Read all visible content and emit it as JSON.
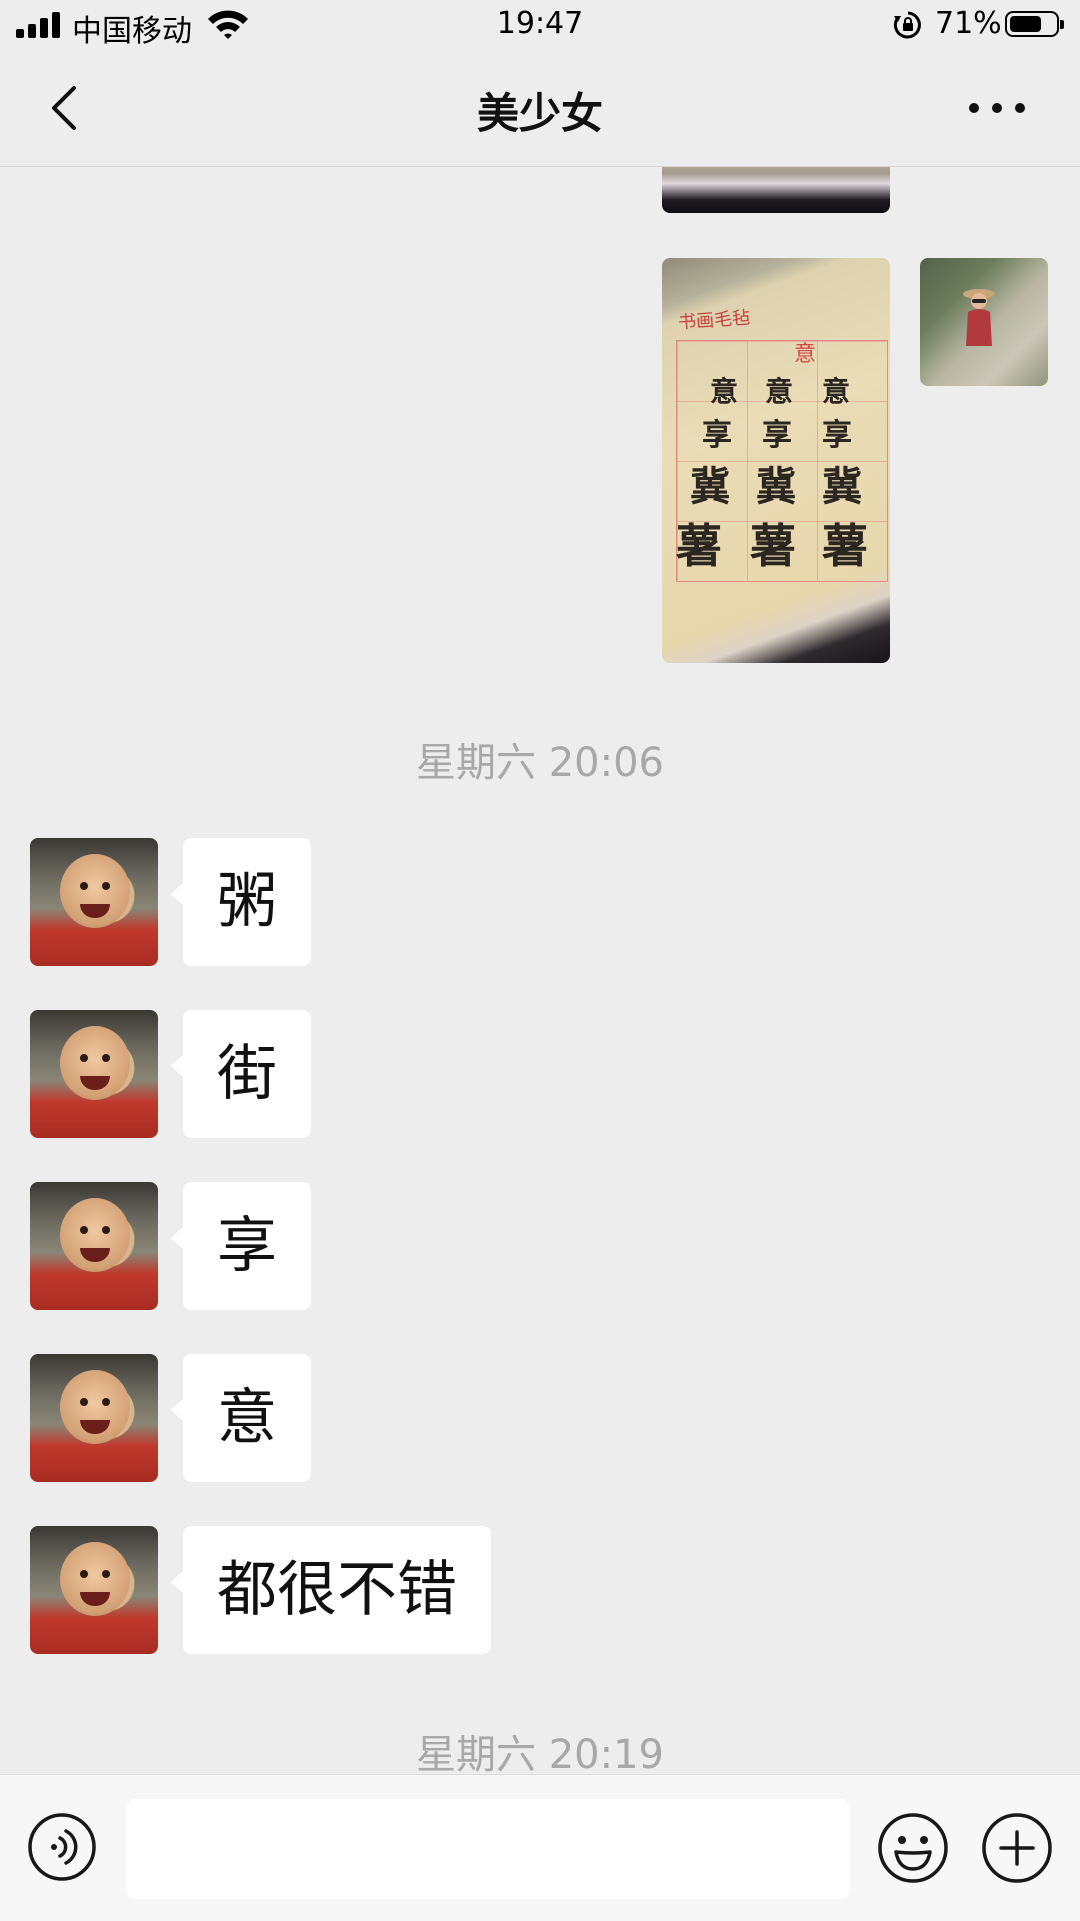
{
  "status_bar": {
    "carrier": "中国移动",
    "time": "19:47",
    "battery_percent": "71%",
    "battery_level": 0.71,
    "icons": [
      "signal-icon",
      "wifi-icon",
      "rotation-lock-icon",
      "battery-icon"
    ]
  },
  "nav": {
    "title": "美少女",
    "back_icon": "chevron-left-icon",
    "more_icon": "more-dots-icon"
  },
  "photo_text": {
    "felt_title": "书画毛毡",
    "highlight": "意",
    "rows": [
      [
        "意",
        "意",
        "意"
      ],
      [
        "享",
        "享",
        "享"
      ],
      [
        "冀",
        "冀",
        "冀"
      ],
      [
        "薯",
        "薯",
        "薯"
      ]
    ]
  },
  "messages": {
    "time_1": "星期六 20:06",
    "incoming": [
      {
        "text": "粥"
      },
      {
        "text": "街"
      },
      {
        "text": "享"
      },
      {
        "text": "意"
      },
      {
        "text": "都很不错"
      }
    ],
    "time_2": "星期六 20:19"
  },
  "input_bar": {
    "voice_icon": "voice-icon",
    "text_value": "",
    "emoji_icon": "emoji-icon",
    "plus_icon": "plus-circle-icon"
  },
  "colors": {
    "background": "#ededed",
    "bubble_incoming": "#ffffff",
    "time_label": "#a8a8a8"
  }
}
